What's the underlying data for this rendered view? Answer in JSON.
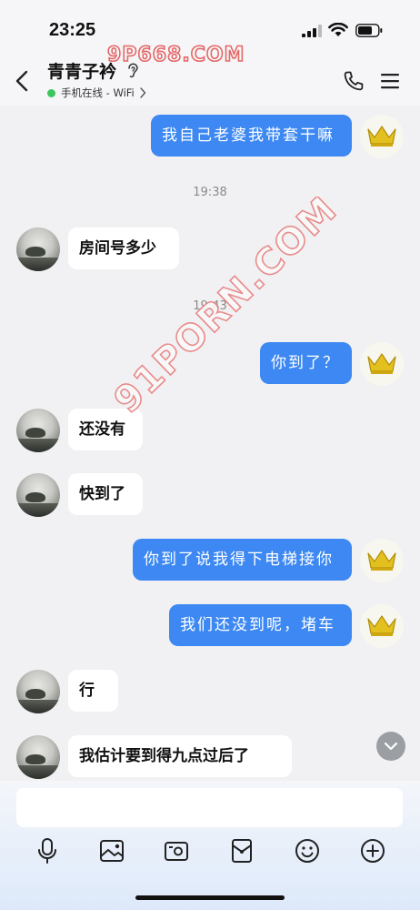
{
  "status_bar": {
    "time": "23:25"
  },
  "header": {
    "contact_name": "青青子衿",
    "online_status": "手机在线 - WiFi",
    "watermark_top": "9P668.COM"
  },
  "watermark_diagonal": "91PORN.COM",
  "messages": [
    {
      "side": "out",
      "text": "我自己老婆我带套干嘛"
    },
    {
      "type": "timestamp",
      "text": "19:38"
    },
    {
      "side": "in",
      "text": "房间号多少"
    },
    {
      "type": "timestamp",
      "text": "19:43"
    },
    {
      "side": "out",
      "text": "你到了？"
    },
    {
      "side": "in",
      "text": "还没有"
    },
    {
      "side": "in",
      "text": "快到了"
    },
    {
      "side": "out",
      "text": "你到了说我得下电梯接你"
    },
    {
      "side": "out",
      "text": "我们还没到呢，堵车"
    },
    {
      "side": "in",
      "text": "行"
    },
    {
      "side": "in",
      "text": "我估计要到得九点过后了"
    }
  ],
  "input": {
    "placeholder": ""
  },
  "toolbar": [
    "microphone-icon",
    "image-icon",
    "camera-icon",
    "red-packet-icon",
    "emoji-icon",
    "plus-icon"
  ],
  "colors": {
    "outgoing_bubble": "#3d88f2",
    "incoming_bubble": "#ffffff",
    "online_dot": "#3cc65d",
    "watermark": "#e46868",
    "crown": "#e3c01e"
  }
}
